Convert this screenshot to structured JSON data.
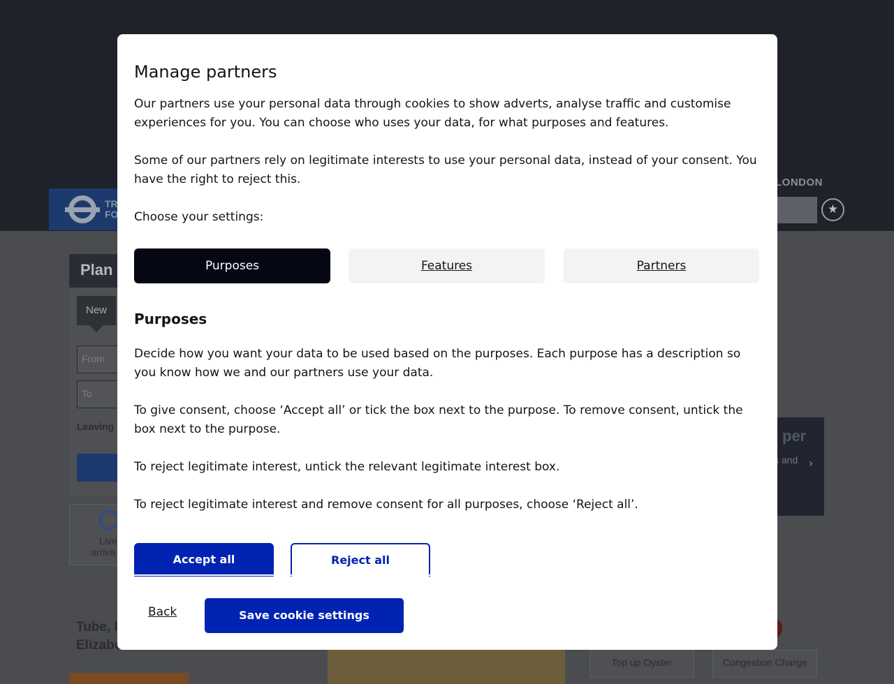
{
  "background": {
    "header": {
      "logo_text_line1": "TR",
      "logo_text_line2": "FO",
      "london_label": "LONDON",
      "favourite_icon": "star-icon"
    },
    "plan_journey": {
      "title": "Plan",
      "new_tab": "New",
      "from_placeholder": "From",
      "to_placeholder": "To",
      "leaving_label": "Leaving",
      "live_arrivals_line1": "Live",
      "live_arrivals_line2": "arriva"
    },
    "promo": {
      "title": "per",
      "subtitle": "s and"
    },
    "status": {
      "line1": "Tube, l",
      "line2": "Elizabe"
    },
    "tiles": [
      "Top up Oyster",
      "Congestion Charge"
    ]
  },
  "modal": {
    "title": "Manage partners",
    "intro1": "Our partners use your personal data through cookies to show adverts, analyse traffic and customise experiences for you. You can choose who uses your data, for what purposes and features.",
    "intro2": "Some of our partners rely on legitimate interests to use your personal data, instead of your consent. You have the right to reject this.",
    "choose_label": "Choose your settings:",
    "tabs": [
      {
        "label": "Purposes",
        "active": true
      },
      {
        "label": "Features",
        "active": false
      },
      {
        "label": "Partners",
        "active": false
      }
    ],
    "section_title": "Purposes",
    "desc1": "Decide how you want your data to be used based on the purposes. Each purpose has a description so you know how we and our partners use your data.",
    "desc2": "To give consent, choose ‘Accept all’ or tick the box next to the purpose. To remove consent, untick the box next to the purpose.",
    "desc3": "To reject legitimate interest, untick the relevant legitimate interest box.",
    "desc4": "To reject legitimate interest and remove consent for all purposes, choose ‘Reject all’.",
    "accept_all": "Accept all",
    "reject_all": "Reject all",
    "back": "Back",
    "save": "Save cookie settings"
  },
  "colors": {
    "primary_blue": "#0023b2",
    "active_tab": "#050814",
    "inactive_tab": "#f1f3f4",
    "overlay_dark": "#1f2228"
  }
}
